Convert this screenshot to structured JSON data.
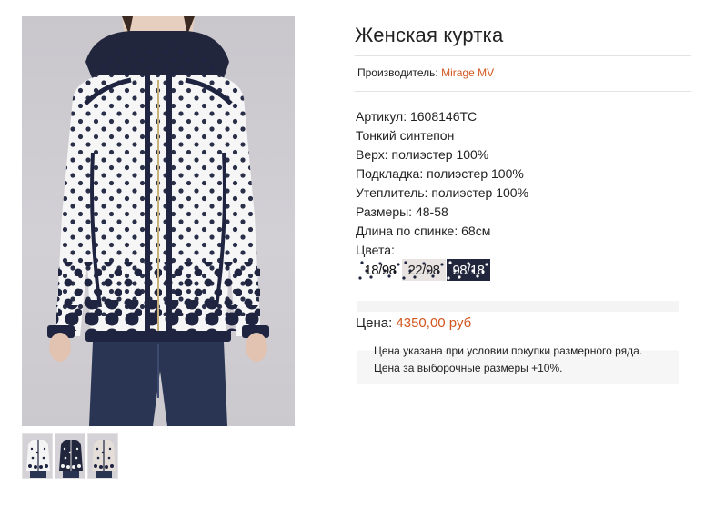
{
  "product": {
    "title": "Женская куртка",
    "maker_label": "Производитель:",
    "maker_name": "Mirage MV",
    "specs": [
      "Артикул: 1608146ТС",
      "Тонкий синтепон",
      "Верх: полиэстер 100%",
      "Подкладка: полиэстер 100%",
      "Утеплитель: полиэстер 100%",
      "Размеры: 48-58",
      "Длина по спинке: 68см",
      "Цвета:"
    ],
    "colors": [
      {
        "label": "18/98",
        "bg": "#ffffff",
        "dot": "#1f2540",
        "text": "#111111"
      },
      {
        "label": "22/98",
        "bg": "#e9e4e2",
        "dot": "#1f2540",
        "text": "#222222"
      },
      {
        "label": "98/18",
        "bg": "#22263d",
        "dot": "#ffffff",
        "text": "#ffffff"
      }
    ],
    "price_label": "Цена:",
    "price_value": "4350,00 руб",
    "notes": [
      "Цена указана при условии покупки размерного ряда.",
      "Цена за выборочные размеры +10%."
    ]
  },
  "gallery": {
    "main_image": "woman-in-polka-dot-jacket-photo",
    "thumbnails": [
      "white-jacket-thumb",
      "navy-jacket-thumb",
      "beige-jacket-thumb"
    ]
  },
  "colors": {
    "accent": "#d2551d",
    "navy": "#1f2540",
    "divider": "#e3e3e3"
  }
}
